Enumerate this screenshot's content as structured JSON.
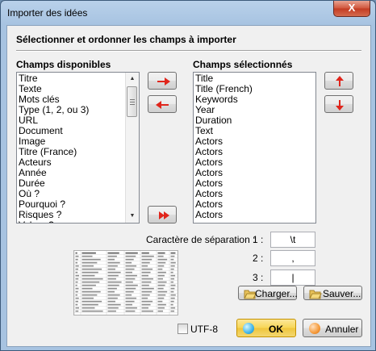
{
  "window": {
    "title": "Importer des idées",
    "close_label": "X"
  },
  "heading": "Sélectionner et ordonner les champs à importer",
  "available": {
    "label": "Champs disponibles",
    "items": [
      "Titre",
      "Texte",
      "Mots clés",
      "Type (1, 2, ou 3)",
      "URL",
      "Document",
      "Image",
      "Titre (France)",
      "Acteurs",
      "Année",
      "Durée",
      "Où ?",
      "Pourquoi ?",
      "Risques ?",
      "Valeur ?"
    ]
  },
  "selected": {
    "label": "Champs sélectionnés",
    "items": [
      "Title",
      "Title (French)",
      "Keywords",
      "Year",
      "Duration",
      "Text",
      "Actors",
      "Actors",
      "Actors",
      "Actors",
      "Actors",
      "Actors",
      "Actors",
      "Actors"
    ]
  },
  "separator": {
    "label": "Caractère de séparation :",
    "rows": [
      {
        "num": "1 :",
        "value": "\\t"
      },
      {
        "num": "2 :",
        "value": ","
      },
      {
        "num": "3 :",
        "value": "|"
      }
    ]
  },
  "buttons": {
    "load": "Charger...",
    "save": "Sauver...",
    "ok": "OK",
    "cancel": "Annuler"
  },
  "utf8_label": "UTF-8",
  "accent": {
    "red_arrow": "#e0251b",
    "ok_gold": "#f7d655",
    "title_bar": "#b9d1ea"
  }
}
